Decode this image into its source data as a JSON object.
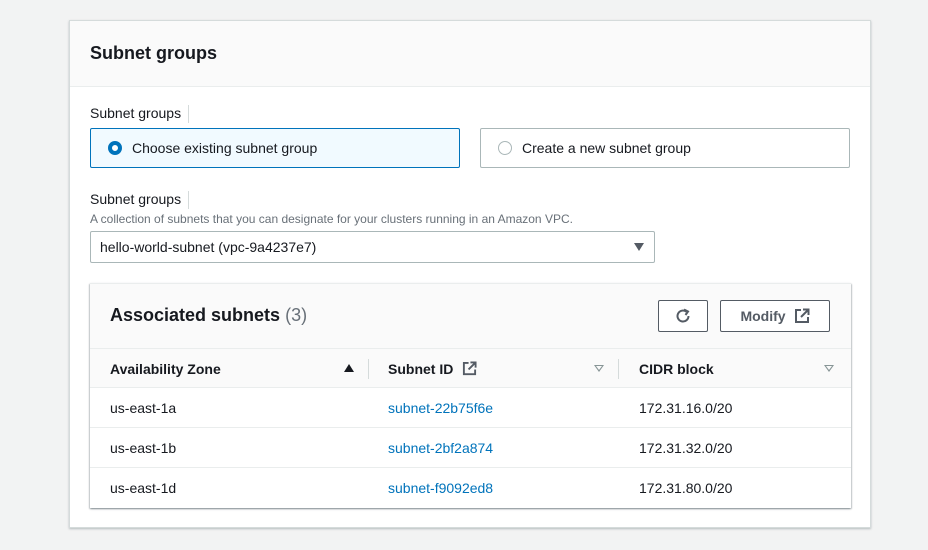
{
  "panel": {
    "title": "Subnet groups"
  },
  "choice_field": {
    "label": "Subnet groups",
    "options": [
      {
        "label": "Choose existing subnet group",
        "selected": true
      },
      {
        "label": "Create a new subnet group",
        "selected": false
      }
    ]
  },
  "select_field": {
    "label": "Subnet groups",
    "description": "A collection of subnets that you can designate for your clusters running in an Amazon VPC.",
    "value": "hello-world-subnet (vpc-9a4237e7)"
  },
  "subnets_table": {
    "title": "Associated subnets",
    "count": "(3)",
    "refresh_icon": "refresh-icon",
    "modify_label": "Modify",
    "columns": [
      {
        "label": "Availability Zone",
        "sort": "ascending"
      },
      {
        "label": "Subnet ID",
        "sort": "none",
        "icon": "external-link-icon"
      },
      {
        "label": "CIDR block",
        "sort": "none"
      }
    ],
    "rows": [
      {
        "az": "us-east-1a",
        "subnet_id": "subnet-22b75f6e",
        "cidr": "172.31.16.0/20"
      },
      {
        "az": "us-east-1b",
        "subnet_id": "subnet-2bf2a874",
        "cidr": "172.31.32.0/20"
      },
      {
        "az": "us-east-1d",
        "subnet_id": "subnet-f9092ed8",
        "cidr": "172.31.80.0/20"
      }
    ]
  },
  "colors": {
    "accent": "#0073bb",
    "page_bg": "#f2f3f3",
    "text": "#16191f",
    "muted": "#687078"
  }
}
